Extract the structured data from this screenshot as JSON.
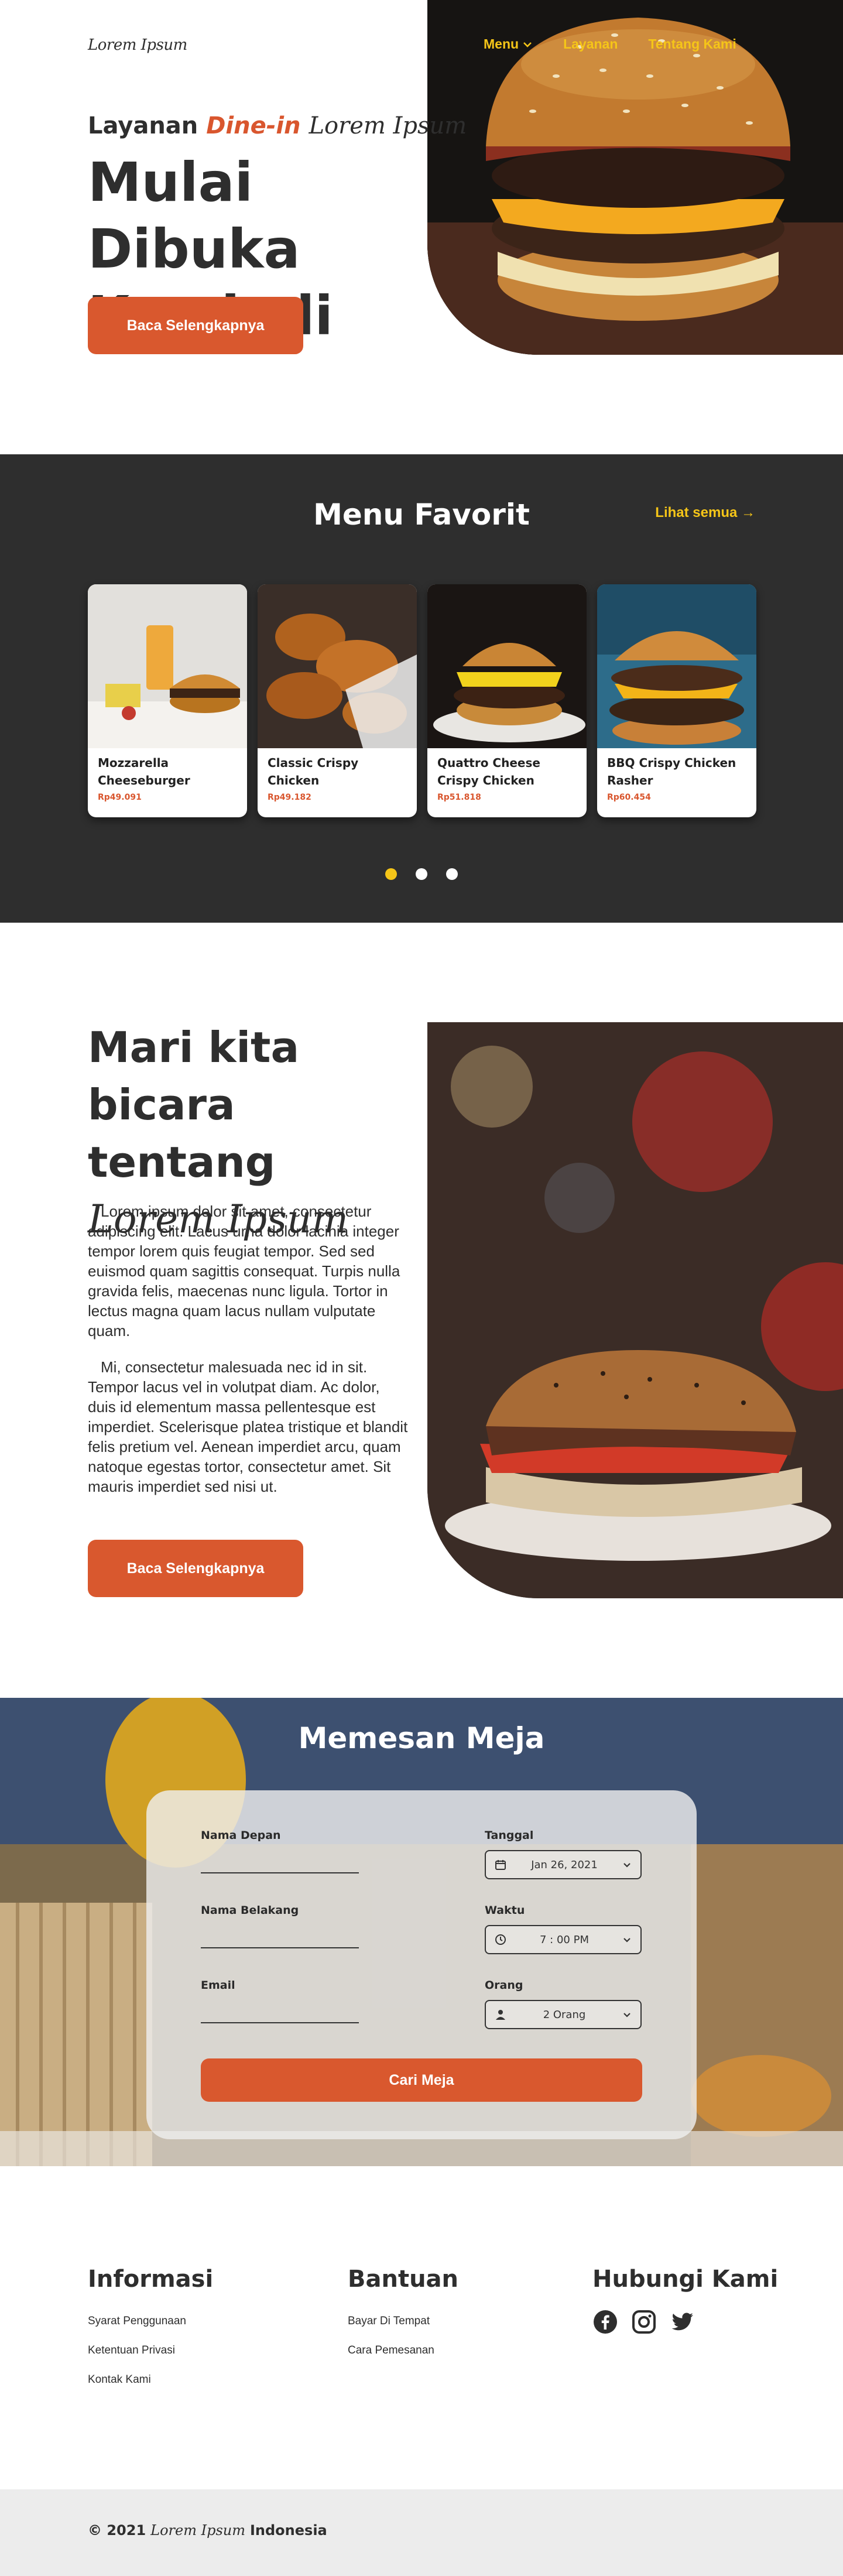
{
  "brand": {
    "logo": "Lorem Ipsum",
    "accent": "#d9582e",
    "yellow": "#f5c518",
    "dark": "#2e2e2e"
  },
  "nav": {
    "items": [
      {
        "label": "Menu",
        "icon": "chevron-down-icon"
      },
      {
        "label": "Layanan"
      },
      {
        "label": "Tentang Kami"
      }
    ]
  },
  "hero": {
    "subtitle_prefix": "Layanan",
    "subtitle_accent": "Dine-in",
    "subtitle_script": "Lorem Ipsum",
    "title_line1": "Mulai Dibuka",
    "title_line2": "Kembali",
    "button": "Baca Selengkapnya"
  },
  "menu": {
    "title": "Menu Favorit",
    "see_all": "Lihat semua →",
    "cards": [
      {
        "name": "Mozzarella Cheeseburger",
        "price": "Rp49.091"
      },
      {
        "name": "Classic Crispy Chicken",
        "price": "Rp49.182"
      },
      {
        "name": "Quattro Cheese Crispy Chicken",
        "price": "Rp51.818"
      },
      {
        "name": "BBQ Crispy Chicken Rasher",
        "price": "Rp60.454"
      }
    ],
    "pagination_active": 1,
    "pagination_count": 3
  },
  "about": {
    "title_line1": "Mari kita",
    "title_line2": "bicara tentang",
    "title_script": "Lorem Ipsum",
    "para1": "Lorem ipsum dolor sit amet, consectetur adipiscing elit. Lacus urna dolor lacinia integer tempor lorem quis feugiat tempor. Sed sed euismod quam sagittis consequat. Turpis nulla gravida felis, maecenas nunc ligula. Tortor in lectus magna quam lacus nullam vulputate quam.",
    "para2": "Mi, consectetur malesuada nec id in sit. Tempor lacus vel in volutpat diam. Ac dolor, duis id elementum massa pellentesque est imperdiet. Scelerisque platea tristique et blandit felis pretium vel. Aenean imperdiet arcu, quam natoque egestas tortor, consectetur amet. Sit mauris imperdiet sed nisi ut.",
    "button": "Baca Selengkapnya"
  },
  "reservation": {
    "title": "Memesan Meja",
    "first_name_label": "Nama Depan",
    "last_name_label": "Nama Belakang",
    "email_label": "Email",
    "date_label": "Tanggal",
    "date_value": "Jan 26, 2021",
    "time_label": "Waktu",
    "time_value": "7 : 00 PM",
    "people_label": "Orang",
    "people_value": "2 Orang",
    "button": "Cari Meja"
  },
  "footer": {
    "info_title": "Informasi",
    "info_links": [
      "Syarat Penggunaan",
      "Ketentuan Privasi",
      "Kontak Kami"
    ],
    "help_title": "Bantuan",
    "help_links": [
      "Bayar Di Tempat",
      "Cara Pemesanan"
    ],
    "contact_title": "Hubungi Kami",
    "social_icons": [
      "facebook-icon",
      "instagram-icon",
      "twitter-icon"
    ],
    "copyright_prefix": "© 2021",
    "copyright_script": "Lorem Ipsum",
    "copyright_suffix": "Indonesia"
  }
}
